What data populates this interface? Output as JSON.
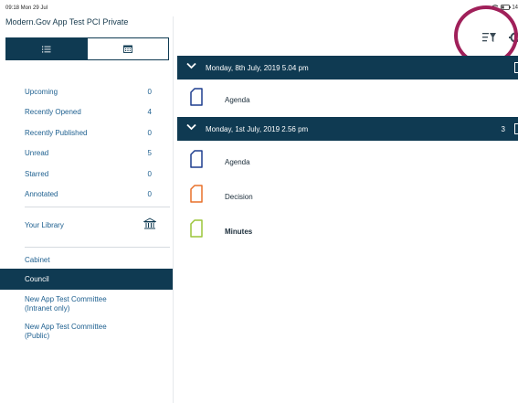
{
  "status_bar": {
    "time": "09:18  Mon 29 Jul",
    "battery": "14"
  },
  "app_title": "Modern.Gov App Test PCI Private",
  "view_toggle": {
    "list_icon": "list-icon",
    "calendar_icon": "calendar-icon"
  },
  "sidebar": {
    "items": [
      {
        "label": "Upcoming",
        "count": "0"
      },
      {
        "label": "Recently Opened",
        "count": "4"
      },
      {
        "label": "Recently Published",
        "count": "0"
      },
      {
        "label": "Unread",
        "count": "5"
      },
      {
        "label": "Starred",
        "count": "0"
      },
      {
        "label": "Annotated",
        "count": "0"
      }
    ],
    "library_label": "Your Library",
    "committees": [
      {
        "label": "Cabinet",
        "selected": false
      },
      {
        "label": "Council",
        "selected": true
      },
      {
        "label": "New App Test Committee\n(Intranet only)",
        "selected": false
      },
      {
        "label": "New App Test Committee\n(Public)",
        "selected": false
      }
    ]
  },
  "toolbar": {
    "filter_icon": "filter-icon",
    "settings_icon": "gear-icon"
  },
  "meetings": [
    {
      "title": "Monday, 8th July, 2019 5.04 pm",
      "count": "",
      "documents": [
        {
          "label": "Agenda",
          "color": "#1f3f8f"
        }
      ]
    },
    {
      "title": "Monday, 1st July, 2019 2.56 pm",
      "count": "3",
      "documents": [
        {
          "label": "Agenda",
          "color": "#1f3f8f"
        },
        {
          "label": "Decision",
          "color": "#e8702a"
        },
        {
          "label": "Minutes",
          "color": "#9cc63a",
          "bold": true
        }
      ]
    }
  ],
  "colors": {
    "navy": "#0f3a52",
    "link_blue": "#1d5f8f",
    "highlight_ring": "#a0205a"
  }
}
